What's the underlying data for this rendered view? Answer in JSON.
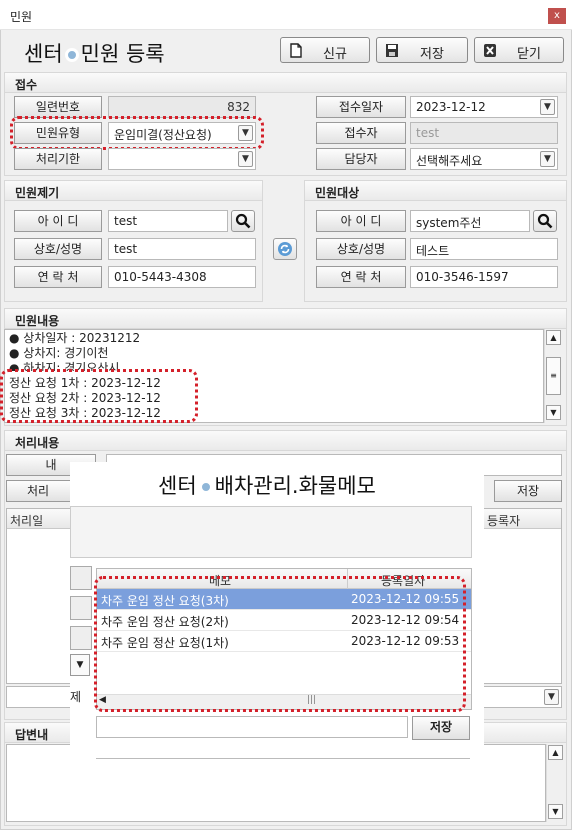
{
  "window": {
    "title": "민원",
    "close_label": "x"
  },
  "header": {
    "title_left": "센터",
    "title_right": "민원 등록",
    "buttons": {
      "new_label": "신규",
      "save_label": "저장",
      "close_label": "닫기"
    }
  },
  "receipt": {
    "title": "접수",
    "serial_label": "일련번호",
    "serial_value": "832",
    "type_label": "민원유형",
    "type_value": "운임미결(정산요청)",
    "deadline_label": "처리기한",
    "deadline_value": "",
    "date_label": "접수일자",
    "date_value": "2023-12-12",
    "receiver_label": "접수자",
    "receiver_value": "test",
    "manager_label": "담당자",
    "manager_value": "선택해주세요"
  },
  "complainant": {
    "title": "민원제기",
    "id_label": "아 이 디",
    "id_value": "test",
    "name_label": "상호/성명",
    "name_value": "test",
    "contact_label": "연 락 처",
    "contact_value": "010-5443-4308"
  },
  "target": {
    "title": "민원대상",
    "id_label": "아 이 디",
    "id_value": "system주선",
    "name_label": "상호/성명",
    "name_value": "테스트",
    "contact_label": "연 락 처",
    "contact_value": "010-3546-1597"
  },
  "content": {
    "title": "민원내용",
    "lines": [
      "● 상차일자 : 20231212",
      "● 상차지: 경기이천",
      "● 하차지: 경기오산시",
      "정산 요청 1차 : 2023-12-12",
      "정산 요청 2차 : 2023-12-12",
      "정산 요청 3차 : 2023-12-12"
    ]
  },
  "process": {
    "title": "처리내용",
    "content_label": "내",
    "processor_label": "처리",
    "save_label": "저장",
    "grid_col_first": "처리일",
    "grid_col_registrant": "등록자",
    "delete_label": "제"
  },
  "answer": {
    "title": "답변내"
  },
  "overlay": {
    "title_left": "센터",
    "title_right": "배차관리.화물메모",
    "col_memo": "메모",
    "col_date": "등록일자",
    "rows": [
      {
        "memo": "차주 운임 정산 요청(3차)",
        "date": "2023-12-12 09:55"
      },
      {
        "memo": "차주 운임 정산 요청(2차)",
        "date": "2023-12-12 09:54"
      },
      {
        "memo": "차주 운임 정산 요청(1차)",
        "date": "2023-12-12 09:53"
      }
    ],
    "save_label": "저장",
    "hscroll_grip": "|||"
  }
}
